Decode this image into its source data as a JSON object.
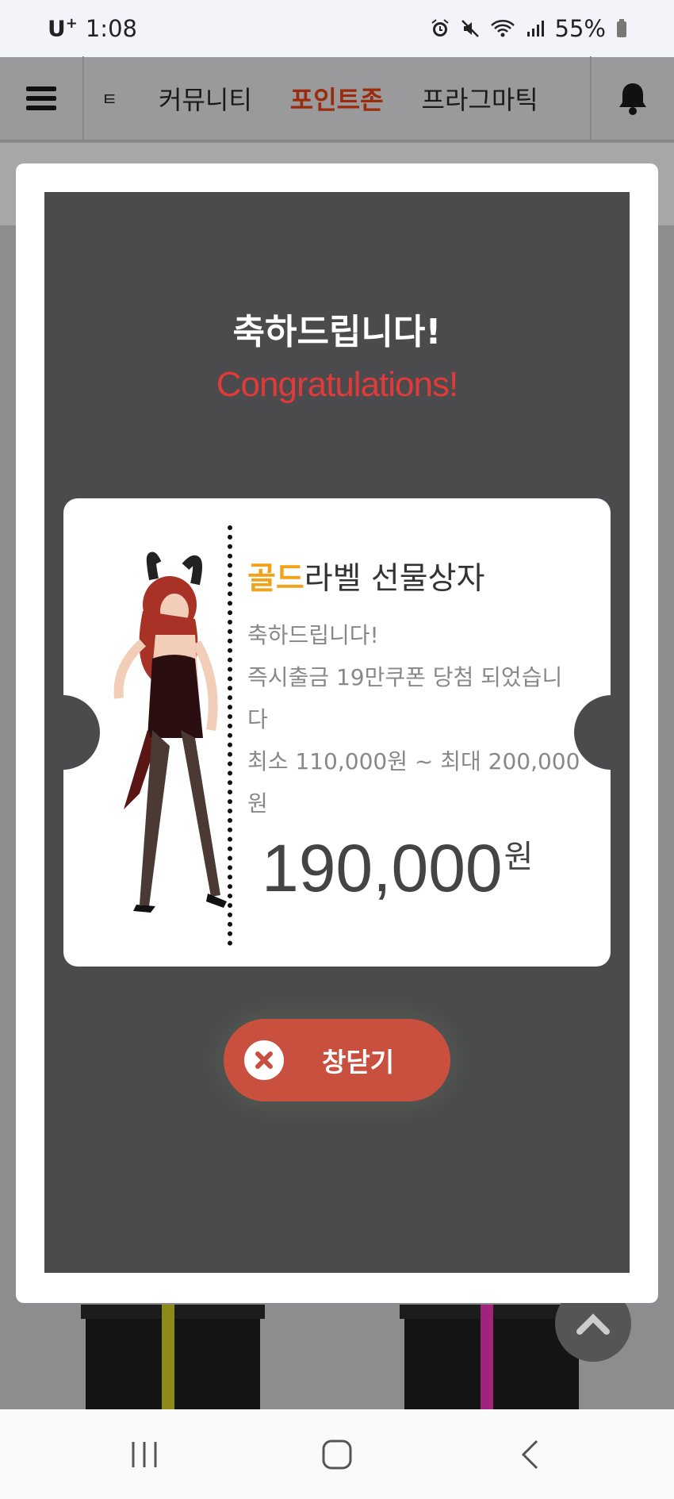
{
  "status_bar": {
    "carrier": "U",
    "carrier_sup": "+",
    "time": "1:08",
    "battery": "55%",
    "icons": [
      "alarm-icon",
      "mute-icon",
      "wifi-icon",
      "signal-icon",
      "battery-icon"
    ]
  },
  "header": {
    "tabs": [
      {
        "label": "ㅌ"
      },
      {
        "label": "커뮤니티"
      },
      {
        "label": "포인트존",
        "active": true
      },
      {
        "label": "프라그마틱"
      }
    ]
  },
  "modal": {
    "title_ko": "축하드립니다!",
    "title_en": "Congratulations!",
    "ticket": {
      "prize_highlight": "골드",
      "prize_rest": "라벨 선물상자",
      "line1": "축하드립니다!",
      "line2": "즉시출금 19만쿠폰 당첨 되었습니다",
      "line3": "최소 110,000원 ~ 최대 200,000원",
      "amount": "190,000",
      "amount_unit": "원"
    },
    "close_label": "창닫기"
  },
  "colors": {
    "accent_red": "#e03a3a",
    "highlight_gold": "#f2a219",
    "active_tab": "#9b2b0b",
    "close_button": "#c9503f"
  }
}
